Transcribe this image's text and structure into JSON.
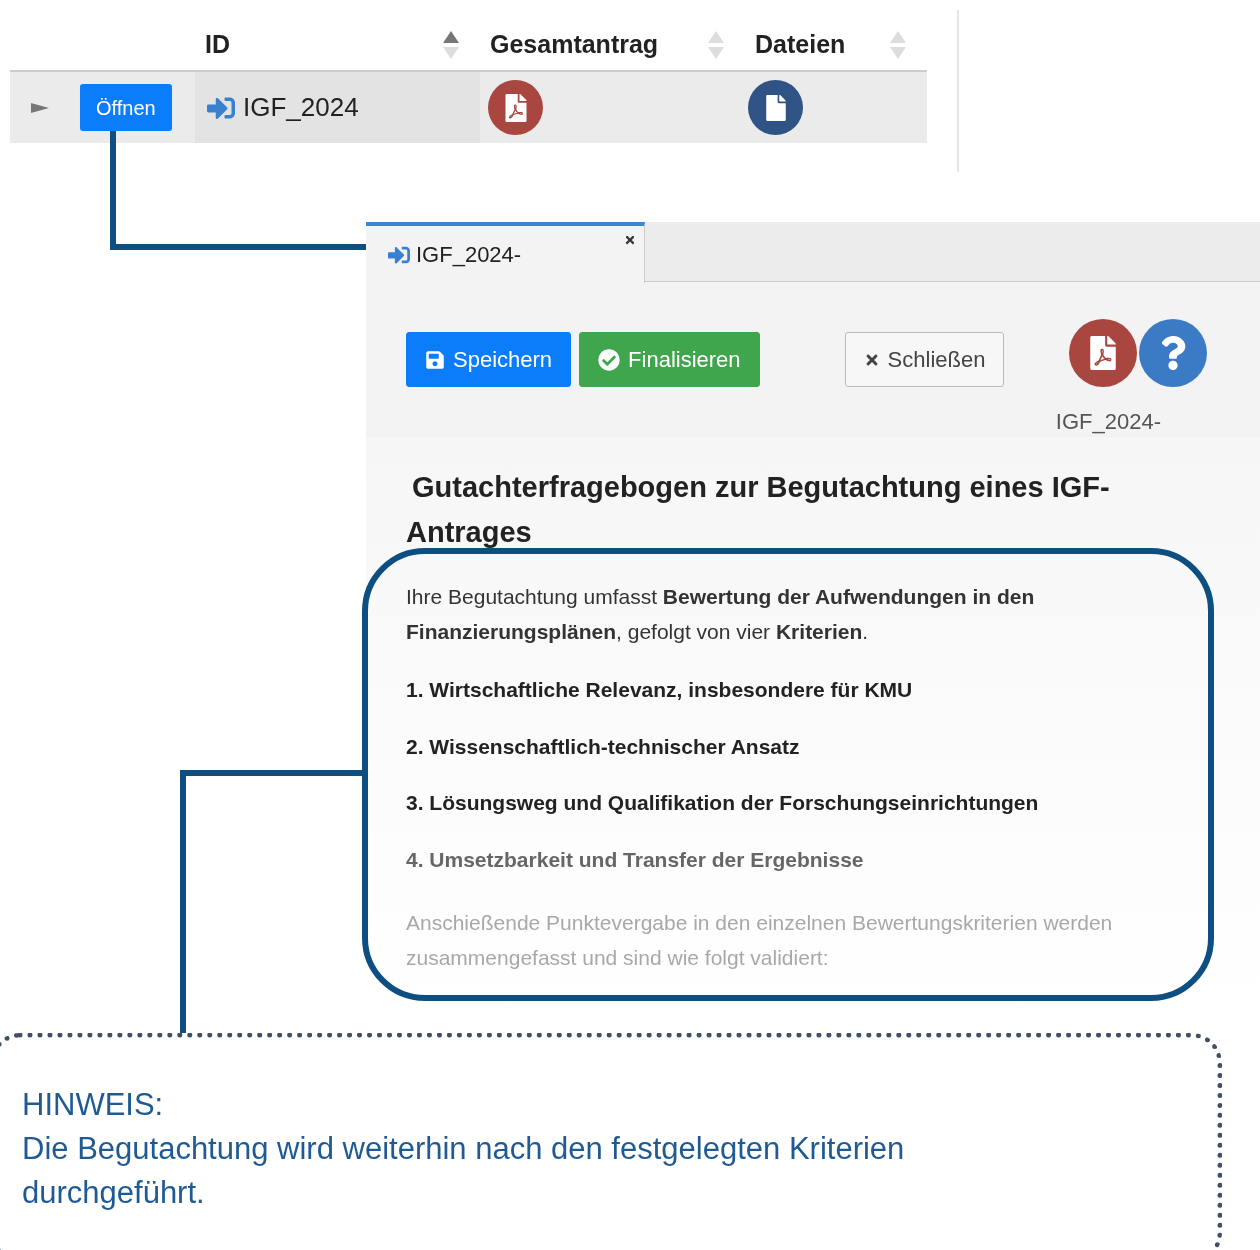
{
  "table": {
    "columns": [
      {
        "label": "ID",
        "sorted": true
      },
      {
        "label": "Gesamtantrag",
        "sorted": false
      },
      {
        "label": "Dateien",
        "sorted": false
      }
    ],
    "rows": [
      {
        "expanded": false,
        "action": "Öffnen",
        "id": "IGF_2024"
      }
    ]
  },
  "panel": {
    "tabs": [
      {
        "label": "IGF_2024-",
        "selected": true
      }
    ],
    "buttons": [
      {
        "label": "Speichern",
        "kind": "primary"
      },
      {
        "label": "Finalisieren",
        "kind": "success"
      },
      {
        "label": "Schließen",
        "kind": "outline"
      }
    ],
    "reference": "IGF_2024-",
    "heading": "Gutachterfragebogen zur Begutachtung eines IGF-Antrages",
    "intro": "Ihre Begutachtung umfasst **Bewertung der Aufwendungen in den Finanzierungsplänen**, gefolgt von vier **Kriterien**.",
    "criteria": [
      {
        "text": "1. Wirtschaftliche Relevanz, insbesondere für KMU",
        "faded": false
      },
      {
        "text": "2. Wissenschaftlich-technischer Ansatz",
        "faded": false
      },
      {
        "text": "3. Lösungsweg und Qualifikation der Forschungseinrichtungen",
        "faded": false
      },
      {
        "text": "4. Umsetzbarkeit und Transfer der Ergebnisse",
        "faded": true
      }
    ],
    "closing": "Anschießende Punktevergabe in den einzelnen Bewertungskriterien werden zusammengefasst und sind wie folgt validiert:"
  },
  "note": {
    "title": "HINWEIS:",
    "text": "Die Begutachtung wird weiterhin nach den festgelegten Kriterien durchgeführt."
  }
}
